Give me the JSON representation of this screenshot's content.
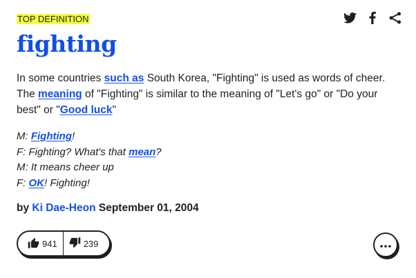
{
  "definition": {
    "badge": "TOP DEFINITION",
    "word": "fighting",
    "meaning": {
      "p1": "In some countries ",
      "link1": "such as",
      "p2": " South Korea, \"Fighting\" is used as words of cheer.",
      "p3": "The ",
      "link2": "meaning",
      "p4": " of \"Fighting\" is similar to the meaning of \"Let's go\" or \"Do your best\" or \"",
      "link3": "Good luck",
      "p5": "\""
    },
    "example": {
      "l1_prefix": "M: ",
      "l1_link": "Fighting",
      "l1_suffix": "!",
      "l2_prefix": "F: Fighting? What's that ",
      "l2_link": "mean",
      "l2_suffix": "?",
      "l3": "M: It means cheer up",
      "l4_prefix": "F: ",
      "l4_link": "OK",
      "l4_suffix": "! Fighting!"
    },
    "byline": {
      "by": "by ",
      "author": "Ki Dae-Heon",
      "date": "September 01, 2004"
    },
    "votes": {
      "up": "941",
      "down": "239"
    }
  },
  "share_icons": [
    "twitter-icon",
    "facebook-icon",
    "share-icon"
  ],
  "colors": {
    "accent": "#134fe6",
    "badge_bg": "#f2ff3f",
    "text": "#1f1f1f"
  }
}
